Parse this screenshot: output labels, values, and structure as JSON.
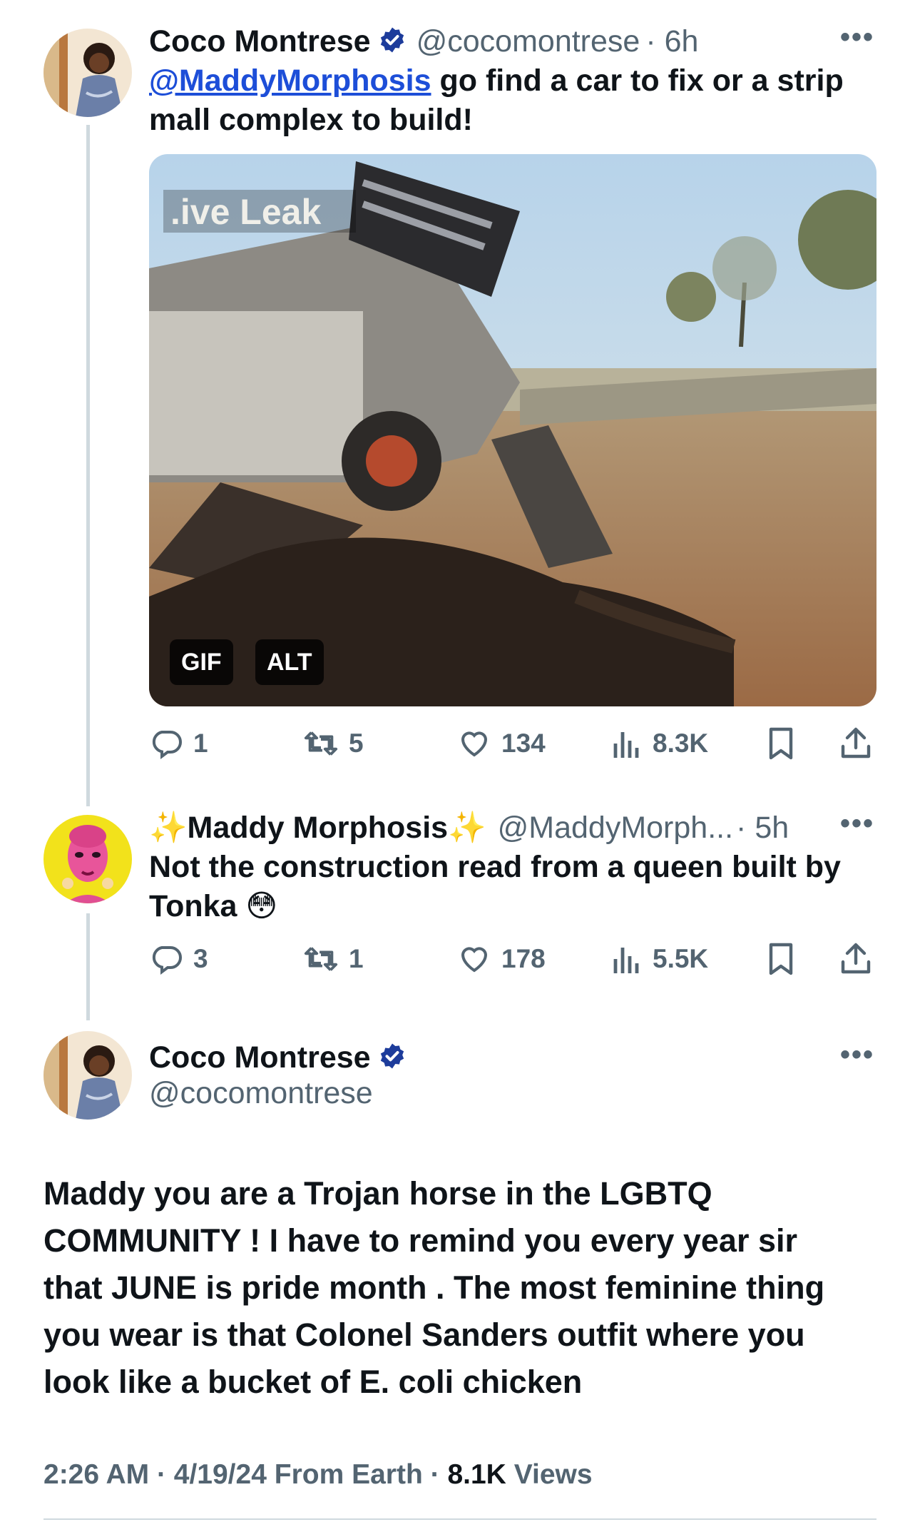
{
  "tweet1": {
    "display_name": "Coco Montrese",
    "handle": "@cocomontrese",
    "time": "· 6h",
    "mention": "@MaddyMorphosis",
    "text_line1": " go  find a car  to fix or a strip",
    "text_line2": "mall complex to build!",
    "media_watermark": ".ive Leak",
    "media_badges": [
      "GIF",
      "ALT"
    ],
    "replies": "1",
    "reposts": "5",
    "likes": "134",
    "views": "8.3K"
  },
  "tweet2": {
    "display_name": "✨Maddy Morphosis✨",
    "handle": "@MaddyMorph...",
    "time": "· 5h",
    "text_line1": "Not the construction read from a queen built by",
    "text_line2": "Tonka 😳",
    "replies": "3",
    "reposts": "1",
    "likes": "178",
    "views": "5.5K"
  },
  "tweet3": {
    "display_name": "Coco Montrese",
    "handle": "@cocomontrese",
    "text_lines": [
      "Maddy you are a Trojan horse  in the LGBTQ",
      "COMMUNITY ! I have to remind you every year sir",
      "that JUNE is pride month . The most feminine thing",
      "you wear is that Colonel Sanders outfit where you",
      "look like a bucket of E. coli chicken"
    ],
    "time": "2:26 AM",
    "date": "4/19/24",
    "source": "From Earth",
    "views_count": "8.1K",
    "views_label": "Views"
  },
  "icons": {
    "more": "more-icon",
    "reply": "reply-icon",
    "repost": "repost-icon",
    "like": "heart-icon",
    "views": "views-icon",
    "bookmark": "bookmark-icon",
    "share": "share-icon",
    "verified": "verified-badge-icon"
  },
  "colors": {
    "text": "#0f1419",
    "secondary": "#536471",
    "link": "#1d4ed8",
    "verified": "#1d3c9b",
    "thread_line": "#cfd9de"
  }
}
